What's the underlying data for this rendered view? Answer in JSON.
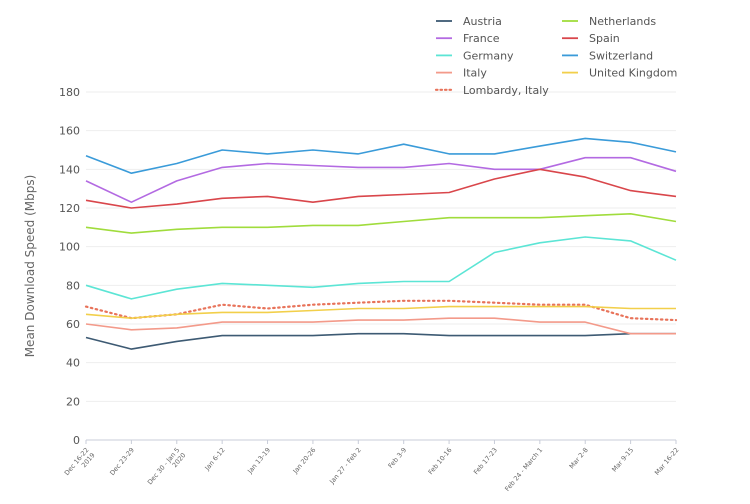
{
  "chart_data": {
    "type": "line",
    "title": "",
    "xlabel": "",
    "ylabel": "Mean Download Speed (Mbps)",
    "ylim": [
      0,
      180
    ],
    "yticks": [
      0,
      20,
      40,
      60,
      80,
      100,
      120,
      140,
      160,
      180
    ],
    "grid": true,
    "legend_placement": "top-right",
    "categories": [
      [
        "Dec 16-22",
        "2019"
      ],
      [
        "Dec 23-29"
      ],
      [
        "Dec 30 - Jan 5",
        "2020"
      ],
      [
        "Jan 6-12"
      ],
      [
        "Jan 13-19"
      ],
      [
        "Jan 20-26"
      ],
      [
        "Jan 27 - Feb 2"
      ],
      [
        "Feb 3-9"
      ],
      [
        "Feb 10-16"
      ],
      [
        "Feb 17-23"
      ],
      [
        "Feb 24 - March 1"
      ],
      [
        "Mar 2-8"
      ],
      [
        "Mar 9-15"
      ],
      [
        "Mar 16-22"
      ]
    ],
    "series": [
      {
        "name": "Austria",
        "color": "#3d5a73",
        "dash": false,
        "values": [
          53,
          47,
          51,
          54,
          54,
          54,
          55,
          55,
          54,
          54,
          54,
          54,
          55,
          55
        ]
      },
      {
        "name": "France",
        "color": "#b36ae2",
        "dash": false,
        "values": [
          134,
          123,
          134,
          141,
          143,
          142,
          141,
          141,
          143,
          140,
          140,
          146,
          146,
          139
        ]
      },
      {
        "name": "Germany",
        "color": "#5ce5d5",
        "dash": false,
        "values": [
          80,
          73,
          78,
          81,
          80,
          79,
          81,
          82,
          82,
          97,
          102,
          105,
          103,
          93
        ]
      },
      {
        "name": "Italy",
        "color": "#f39a8a",
        "dash": false,
        "values": [
          60,
          57,
          58,
          61,
          61,
          61,
          62,
          62,
          63,
          63,
          61,
          61,
          55,
          55
        ]
      },
      {
        "name": "Lombardy, Italy",
        "color": "#e8735a",
        "dash": true,
        "values": [
          69,
          63,
          65,
          70,
          68,
          70,
          71,
          72,
          72,
          71,
          70,
          70,
          63,
          62
        ]
      },
      {
        "name": "Netherlands",
        "color": "#a0dc3c",
        "dash": false,
        "values": [
          110,
          107,
          109,
          110,
          110,
          111,
          111,
          113,
          115,
          115,
          115,
          116,
          117,
          113
        ]
      },
      {
        "name": "Spain",
        "color": "#d9464b",
        "dash": false,
        "values": [
          124,
          120,
          122,
          125,
          126,
          123,
          126,
          127,
          128,
          135,
          140,
          136,
          129,
          126
        ]
      },
      {
        "name": "Switzerland",
        "color": "#3a9bd9",
        "dash": false,
        "values": [
          147,
          138,
          143,
          150,
          148,
          150,
          148,
          153,
          148,
          148,
          152,
          156,
          154,
          149
        ]
      },
      {
        "name": "United Kingdom",
        "color": "#f2cf4a",
        "dash": false,
        "values": [
          65,
          63,
          65,
          66,
          66,
          67,
          68,
          68,
          69,
          69,
          69,
          69,
          68,
          68
        ]
      }
    ]
  }
}
